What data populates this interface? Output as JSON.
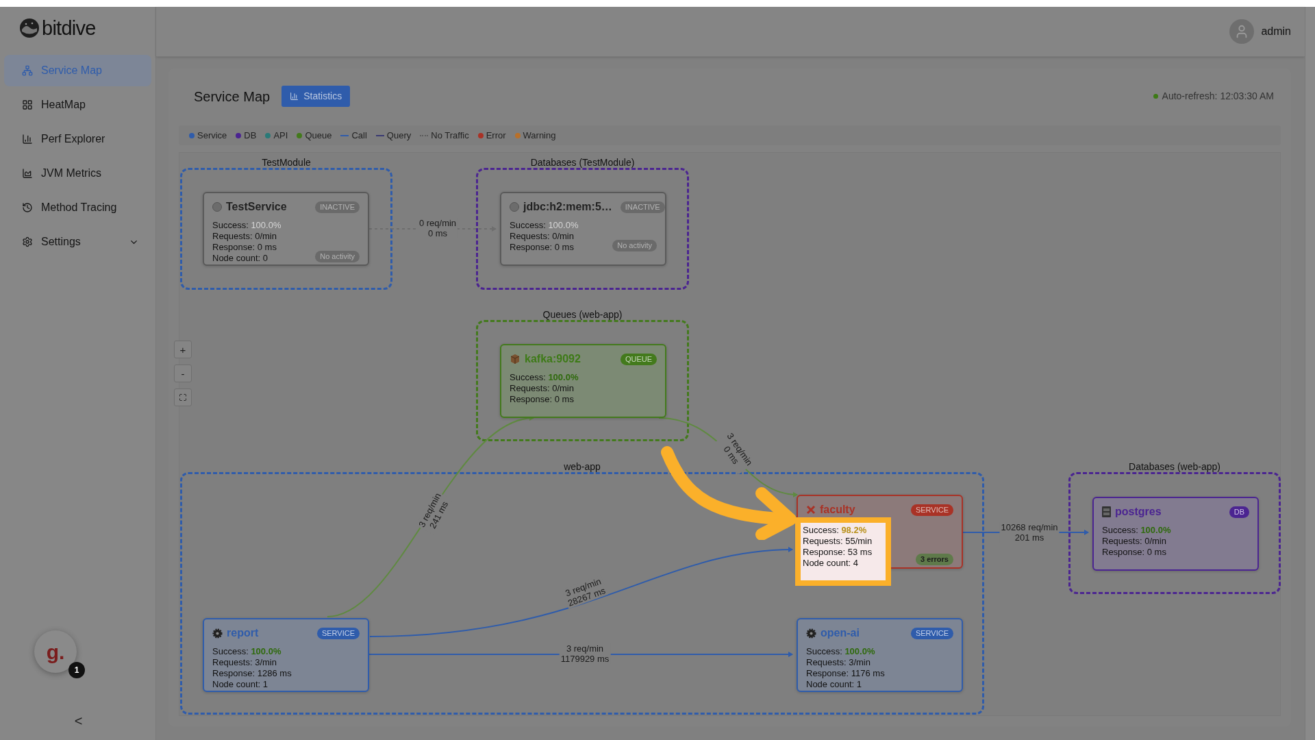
{
  "sidebar": {
    "logo": "bitdive",
    "items": [
      {
        "label": "Service Map",
        "selected": true
      },
      {
        "label": "HeatMap",
        "selected": false
      },
      {
        "label": "Perf Explorer",
        "selected": false
      },
      {
        "label": "JVM Metrics",
        "selected": false
      },
      {
        "label": "Method Tracing",
        "selected": false
      },
      {
        "label": "Settings",
        "selected": false,
        "expanded": false
      }
    ],
    "helper": {
      "label": "g.",
      "count": "1"
    },
    "collapse": "<"
  },
  "header": {
    "user": "admin"
  },
  "page": {
    "title": "Service Map",
    "statistics_button": "Statistics",
    "auto_refresh": "Auto-refresh: 12:03:30 AM"
  },
  "legend": [
    {
      "label": "Service",
      "kind": "dot",
      "color": "#2f5cab"
    },
    {
      "label": "DB",
      "kind": "dot",
      "color": "#4b2491"
    },
    {
      "label": "API",
      "kind": "dot",
      "color": "#2a7a78"
    },
    {
      "label": "Queue",
      "kind": "dot",
      "color": "#437a1c"
    },
    {
      "label": "Call",
      "kind": "line",
      "color": "#2f5cab"
    },
    {
      "label": "Query",
      "kind": "line",
      "color": "#3a3a72"
    },
    {
      "label": "No Traffic",
      "kind": "dashed",
      "color": "#5c5c5c"
    },
    {
      "label": "Error",
      "kind": "dot",
      "color": "#a93226"
    },
    {
      "label": "Warning",
      "kind": "dot",
      "color": "#b8702a"
    }
  ],
  "zoom_controls": [
    "+",
    "-"
  ],
  "groups": [
    {
      "label": "TestModule",
      "kind": "service"
    },
    {
      "label": "Databases (TestModule)",
      "kind": "db"
    },
    {
      "label": "Queues (web-app)",
      "kind": "queue"
    },
    {
      "label": "web-app",
      "kind": "service"
    },
    {
      "label": "Databases (web-app)",
      "kind": "db"
    }
  ],
  "nodes": [
    {
      "name": "TestService",
      "kind": "inactive",
      "badge": "INACTIVE",
      "footer": "No activity",
      "highlighted": false,
      "stats": [
        {
          "label": "Success:",
          "value": "100.0%"
        },
        {
          "label": "Requests:",
          "value": "0/min"
        },
        {
          "label": "Response:",
          "value": "0 ms"
        },
        {
          "label": "Node count:",
          "value": "0"
        }
      ]
    },
    {
      "name": "jdbc:h2:mem:5…",
      "kind": "inactive",
      "badge": "INACTIVE",
      "footer": "No activity",
      "highlighted": false,
      "stats": [
        {
          "label": "Success:",
          "value": "100.0%"
        },
        {
          "label": "Requests:",
          "value": "0/min"
        },
        {
          "label": "Response:",
          "value": "0 ms"
        }
      ]
    },
    {
      "name": "kafka:9092",
      "kind": "queue",
      "badge": "QUEUE",
      "highlighted": false,
      "stats": [
        {
          "label": "Success:",
          "value": "100.0%"
        },
        {
          "label": "Requests:",
          "value": "0/min"
        },
        {
          "label": "Response:",
          "value": "0 ms"
        }
      ]
    },
    {
      "name": "faculty",
      "kind": "error",
      "badge": "SERVICE",
      "footer": "3 errors",
      "highlighted": true,
      "stats": [
        {
          "label": "Success:",
          "value": "98.2%"
        },
        {
          "label": "Requests:",
          "value": "55/min"
        },
        {
          "label": "Response:",
          "value": "53 ms"
        },
        {
          "label": "Node count:",
          "value": "4"
        }
      ]
    },
    {
      "name": "postgres",
      "kind": "db",
      "badge": "DB",
      "highlighted": false,
      "stats": [
        {
          "label": "Success:",
          "value": "100.0%"
        },
        {
          "label": "Requests:",
          "value": "0/min"
        },
        {
          "label": "Response:",
          "value": "0 ms"
        }
      ]
    },
    {
      "name": "report",
      "kind": "service",
      "badge": "SERVICE",
      "highlighted": false,
      "stats": [
        {
          "label": "Success:",
          "value": "100.0%"
        },
        {
          "label": "Requests:",
          "value": "3/min"
        },
        {
          "label": "Response:",
          "value": "1286 ms"
        },
        {
          "label": "Node count:",
          "value": "1"
        }
      ]
    },
    {
      "name": "open-ai",
      "kind": "service",
      "badge": "SERVICE",
      "highlighted": false,
      "stats": [
        {
          "label": "Success:",
          "value": "100.0%"
        },
        {
          "label": "Requests:",
          "value": "3/min"
        },
        {
          "label": "Response:",
          "value": "1176 ms"
        },
        {
          "label": "Node count:",
          "value": "1"
        }
      ]
    }
  ],
  "edges": [
    {
      "kind": "none",
      "lines": [
        "0 req/min",
        "0 ms"
      ]
    },
    {
      "kind": "queue",
      "lines": [
        "3 req/min",
        "241 ms"
      ]
    },
    {
      "kind": "queue",
      "lines": [
        "3 req/min",
        "0 ms"
      ]
    },
    {
      "kind": "call",
      "lines": [
        "3 req/min",
        "28267 ms"
      ]
    },
    {
      "kind": "call",
      "lines": [
        "3 req/min",
        "1179929 ms"
      ]
    },
    {
      "kind": "call",
      "lines": [
        "10268 req/min",
        "201 ms"
      ]
    }
  ]
}
